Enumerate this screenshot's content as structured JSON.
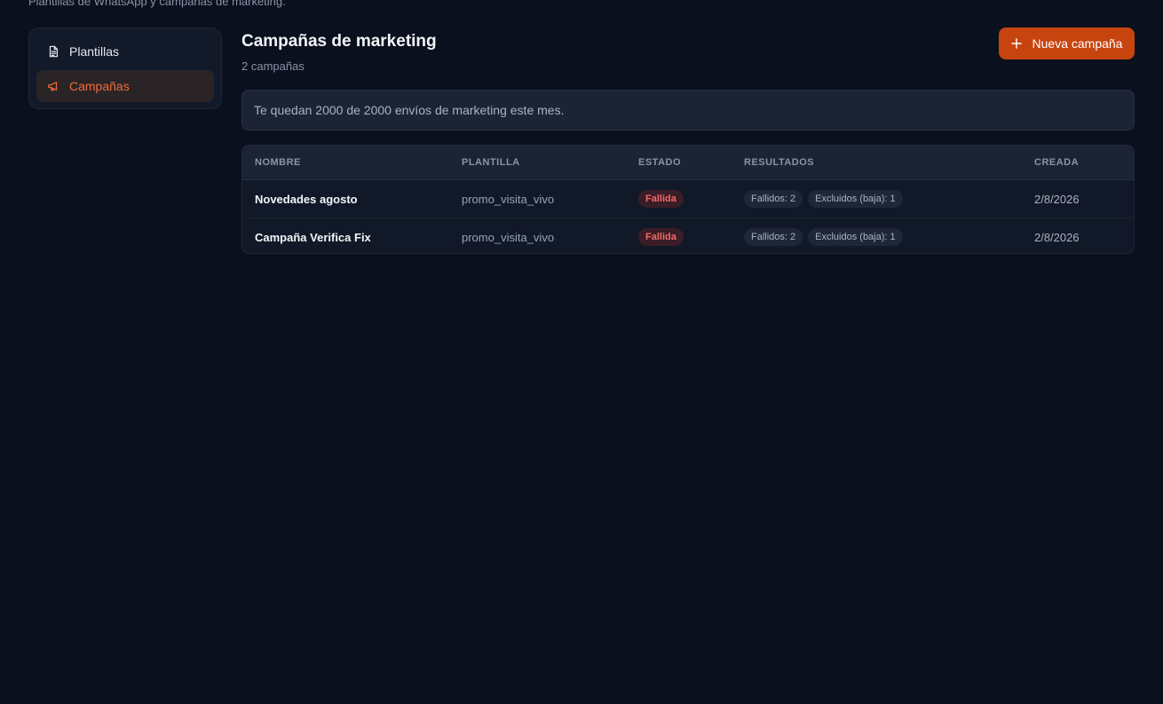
{
  "page": {
    "subtitle": "Plantillas de WhatsApp y campañas de marketing."
  },
  "sidebar": {
    "items": [
      {
        "label": "Plantillas",
        "icon": "document-icon",
        "active": false
      },
      {
        "label": "Campañas",
        "icon": "megaphone-icon",
        "active": true
      }
    ]
  },
  "header": {
    "title": "Campañas de marketing",
    "count": "2 campañas",
    "new_button_label": "Nueva campaña"
  },
  "quota": {
    "text": "Te quedan 2000 de 2000 envíos de marketing este mes."
  },
  "table": {
    "columns": {
      "nombre": "NOMBRE",
      "plantilla": "PLANTILLA",
      "estado": "ESTADO",
      "resultados": "RESULTADOS",
      "creada": "CREADA"
    },
    "rows": [
      {
        "nombre": "Novedades agosto",
        "plantilla": "promo_visita_vivo",
        "estado": "Fallida",
        "fallidos": "Fallidos: 2",
        "excluidos": "Excluidos (baja): 1",
        "creada": "2/8/2026"
      },
      {
        "nombre": "Campaña Verifica Fix",
        "plantilla": "promo_visita_vivo",
        "estado": "Fallida",
        "fallidos": "Fallidos: 2",
        "excluidos": "Excluidos (baja): 1",
        "creada": "2/8/2026"
      }
    ]
  },
  "colors": {
    "background": "#0b101e",
    "accent": "#c8440f",
    "active_text": "#f26b3a",
    "status_failed": "#f26a6a"
  }
}
